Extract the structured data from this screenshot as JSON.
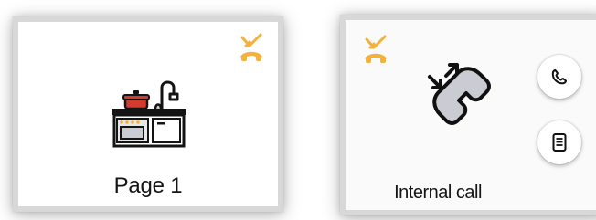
{
  "tiles": [
    {
      "label": "Page 1",
      "icon": "kitchen-sink-stove-icon",
      "status_icon": "missed-call-icon"
    },
    {
      "label": "Internal call",
      "icon": "internal-call-icon",
      "status_icon": "missed-call-icon",
      "buttons": [
        {
          "icon": "phone-icon"
        },
        {
          "icon": "notes-icon"
        }
      ]
    }
  ],
  "colors": {
    "accent": "#f3b23b",
    "text": "#141414",
    "panel_border": "#d8d8d8",
    "icon_gray": "#c9ccd3",
    "red": "#d33b2f"
  }
}
